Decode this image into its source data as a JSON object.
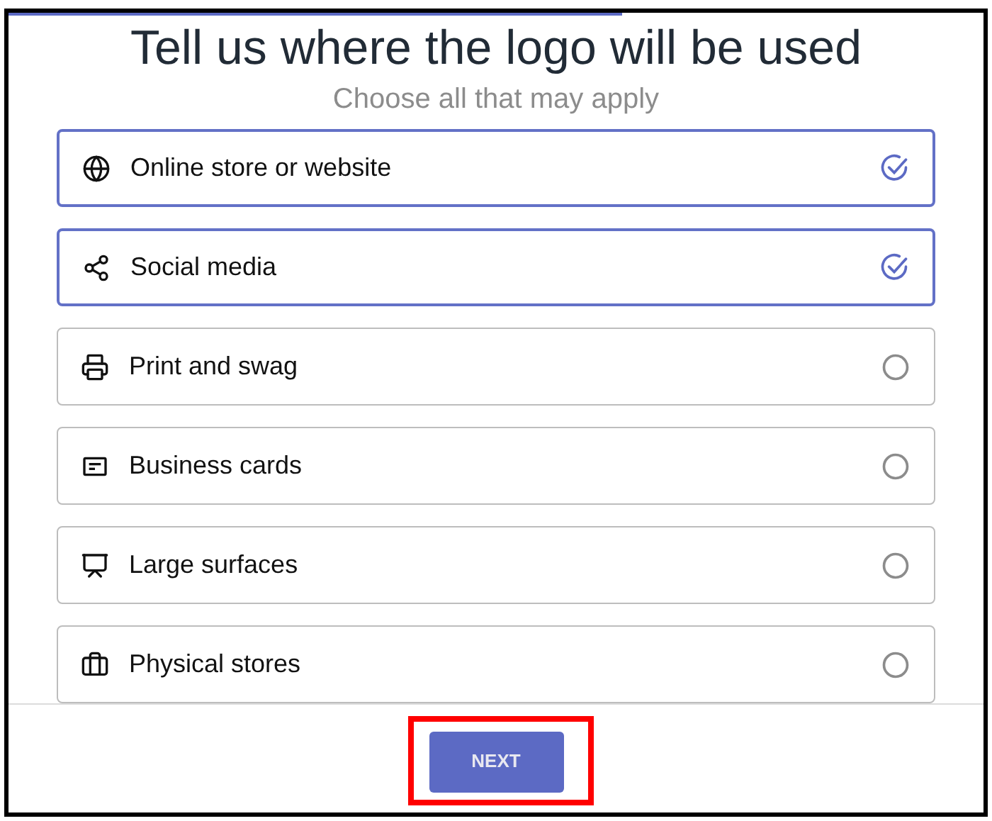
{
  "progress": {
    "level": 0.63
  },
  "title": "Tell us where the logo will be used",
  "subtitle": "Choose all that may apply",
  "options": [
    {
      "label": "Online store or website",
      "selected": true
    },
    {
      "label": "Social media",
      "selected": true
    },
    {
      "label": "Print and swag",
      "selected": false
    },
    {
      "label": "Business cards",
      "selected": false
    },
    {
      "label": "Large surfaces",
      "selected": false
    },
    {
      "label": "Physical stores",
      "selected": false
    }
  ],
  "next_button": "NEXT",
  "highlight": true
}
